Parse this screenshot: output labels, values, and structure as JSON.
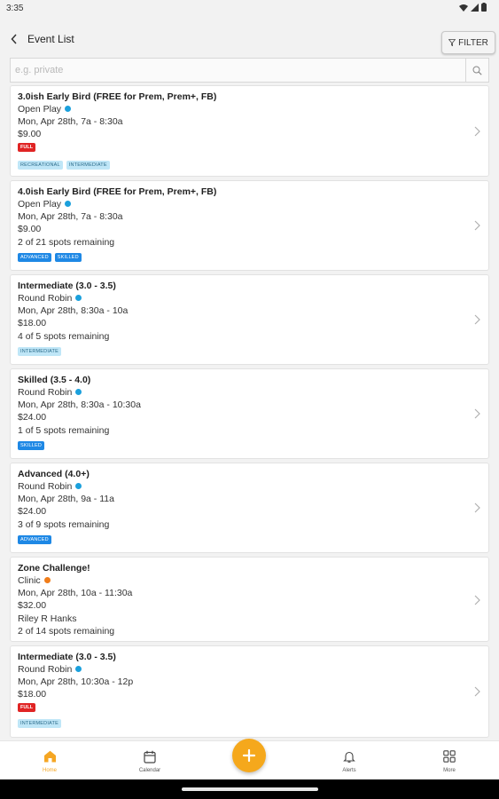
{
  "status_bar": {
    "time": "3:35"
  },
  "header": {
    "title": "Event List",
    "filter_label": "FILTER"
  },
  "search": {
    "placeholder": "e.g. private",
    "value": ""
  },
  "colors": {
    "accent": "#f5a81c",
    "dot_blue": "#1ba0dc",
    "dot_orange": "#f07d1a",
    "full_red": "#e02424",
    "tag_light": "#bfe6f7",
    "tag_dark": "#1e88e5"
  },
  "events": [
    {
      "title": "3.0ish Early Bird (FREE for Prem, Prem+, FB)",
      "type": "Open Play",
      "dot": "blue",
      "datetime": "Mon, Apr 28th, 7a - 8:30a",
      "price": "$9.00",
      "full_label": "FULL",
      "tags": [
        {
          "label": "RECREATIONAL",
          "style": "light"
        },
        {
          "label": "INTERMEDIATE",
          "style": "light"
        }
      ]
    },
    {
      "title": "4.0ish Early Bird (FREE for Prem, Prem+, FB)",
      "type": "Open Play",
      "dot": "blue",
      "datetime": "Mon, Apr 28th, 7a - 8:30a",
      "price": "$9.00",
      "spots": "2 of 21 spots remaining",
      "tags": [
        {
          "label": "ADVANCED",
          "style": "dark"
        },
        {
          "label": "SKILLED",
          "style": "dark"
        }
      ]
    },
    {
      "title": "Intermediate (3.0 - 3.5)",
      "type": "Round Robin",
      "dot": "blue",
      "datetime": "Mon, Apr 28th, 8:30a - 10a",
      "price": "$18.00",
      "spots": "4 of 5 spots remaining",
      "tags": [
        {
          "label": "INTERMEDIATE",
          "style": "light"
        }
      ]
    },
    {
      "title": "Skilled (3.5 - 4.0)",
      "type": "Round Robin",
      "dot": "blue",
      "datetime": "Mon, Apr 28th, 8:30a - 10:30a",
      "price": "$24.00",
      "spots": "1 of 5 spots remaining",
      "tags": [
        {
          "label": "SKILLED",
          "style": "dark"
        }
      ]
    },
    {
      "title": "Advanced (4.0+)",
      "type": "Round Robin",
      "dot": "blue",
      "datetime": "Mon, Apr 28th, 9a - 11a",
      "price": "$24.00",
      "spots": "3 of 9 spots remaining",
      "tags": [
        {
          "label": "ADVANCED",
          "style": "dark"
        }
      ]
    },
    {
      "title": "Zone Challenge!",
      "type": "Clinic",
      "dot": "orange",
      "datetime": "Mon, Apr 28th, 10a - 11:30a",
      "price": "$32.00",
      "instructor": "Riley R Hanks",
      "spots": "2 of 14 spots remaining",
      "tags": []
    },
    {
      "title": "Intermediate (3.0 - 3.5)",
      "type": "Round Robin",
      "dot": "blue",
      "datetime": "Mon, Apr 28th, 10:30a - 12p",
      "price": "$18.00",
      "full_label": "FULL",
      "tags": [
        {
          "label": "INTERMEDIATE",
          "style": "light"
        }
      ]
    }
  ],
  "bottom_nav": {
    "home": "Home",
    "calendar": "Calendar",
    "alerts": "Alerts",
    "more": "More"
  }
}
